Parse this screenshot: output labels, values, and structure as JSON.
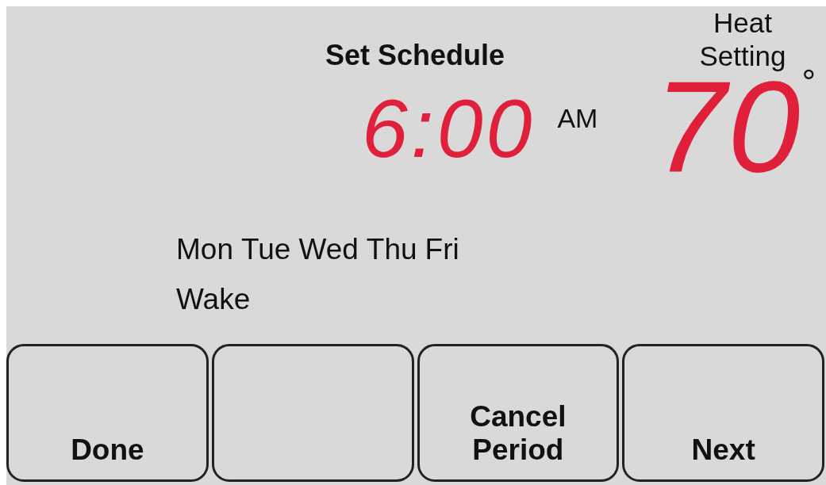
{
  "title": "Set Schedule",
  "time": {
    "value": "6:00",
    "meridiem": "AM"
  },
  "setting": {
    "label": "Heat Setting",
    "value": "70",
    "unit": "°"
  },
  "days": [
    "Mon",
    "Tue",
    "Wed",
    "Thu",
    "Fri"
  ],
  "period": "Wake",
  "buttons": [
    {
      "kind": "labeled",
      "label": "Done"
    },
    {
      "kind": "blank"
    },
    {
      "kind": "labeled",
      "label": "Cancel Period"
    },
    {
      "kind": "labeled",
      "label": "Next"
    }
  ]
}
